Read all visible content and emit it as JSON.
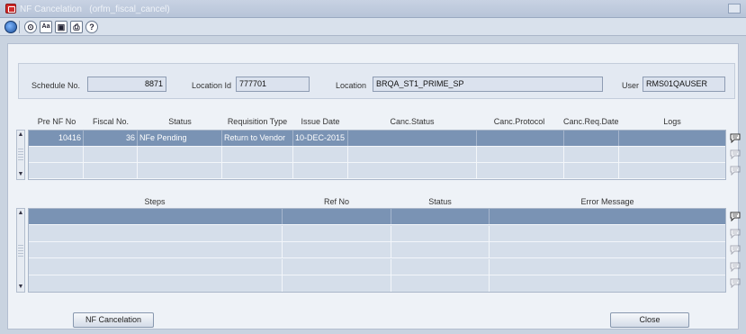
{
  "window": {
    "title": "NF Cancelation   (orfm_fiscal_cancel)"
  },
  "toolbar": {
    "icons": [
      "globe-icon",
      "action-icon",
      "spellcheck-icon",
      "copy-icon",
      "print-icon",
      "help-icon"
    ],
    "labels": [
      "",
      "⊙",
      "Aa",
      "▣",
      "⎙",
      "?"
    ]
  },
  "header": {
    "schedule_label": "Schedule No.",
    "schedule_value": "8871",
    "location_id_label": "Location Id",
    "location_id_value": "777701",
    "location_label": "Location",
    "location_value": "BRQA_ST1_PRIME_SP",
    "user_label": "User",
    "user_value": "RMS01QAUSER"
  },
  "nf_table": {
    "columns": [
      "Pre NF No",
      "Fiscal No.",
      "Status",
      "Requisition Type",
      "Issue Date",
      "Canc.Status",
      "Canc.Protocol",
      "Canc.Req.Date",
      "Logs"
    ],
    "rows": [
      [
        "10416",
        "36",
        "NFe Pending",
        "Return to Vendor",
        "10-DEC-2015",
        "",
        "",
        "",
        ""
      ],
      [
        "",
        "",
        "",
        "",
        "",
        "",
        "",
        "",
        ""
      ],
      [
        "",
        "",
        "",
        "",
        "",
        "",
        "",
        "",
        ""
      ]
    ]
  },
  "steps_table": {
    "columns": [
      "Steps",
      "Ref No",
      "Status",
      "Error Message"
    ],
    "rows": [
      [
        "",
        "",
        "",
        ""
      ],
      [
        "",
        "",
        "",
        ""
      ],
      [
        "",
        "",
        "",
        ""
      ],
      [
        "",
        "",
        "",
        ""
      ],
      [
        "",
        "",
        "",
        ""
      ]
    ]
  },
  "buttons": {
    "nf_cancelation": "NF Cancelation",
    "close": "Close"
  }
}
